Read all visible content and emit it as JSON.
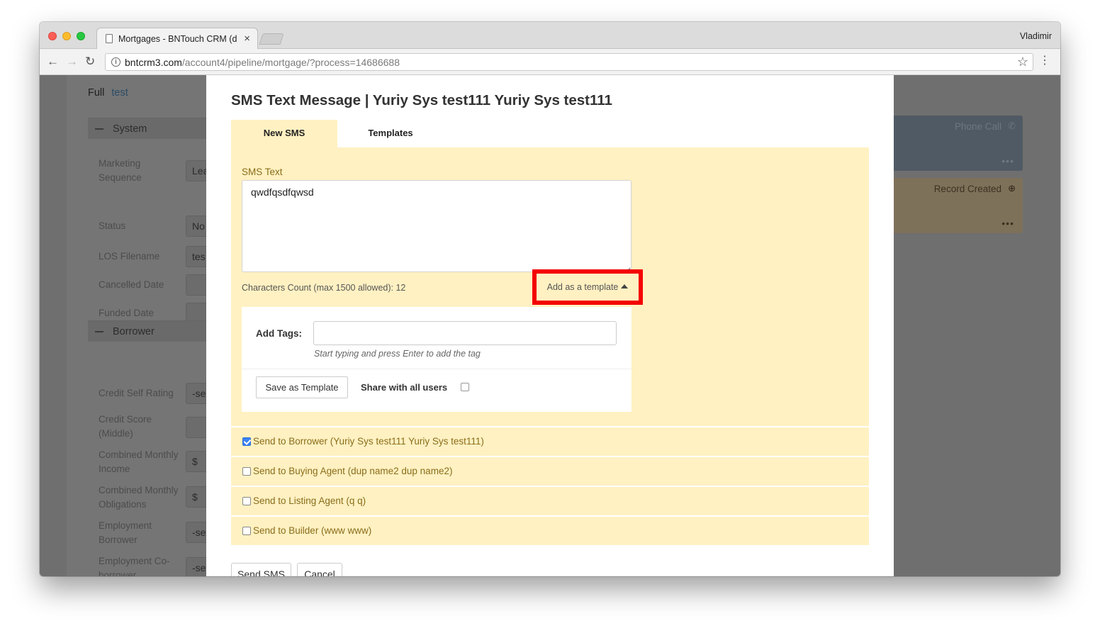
{
  "browser": {
    "tab_title": "Mortgages - BNTouch CRM (d",
    "tab_close": "×",
    "user": "Vladimir",
    "url_host": "bntcrm3.com",
    "url_path": "/account4/pipeline/mortgage/?process=14686688"
  },
  "icons": {
    "back": "←",
    "forward": "→",
    "reload": "↻",
    "info": "i",
    "star": "☆",
    "menu": "⋮",
    "phone": "✆",
    "plus_circle": "⊕",
    "dots": "•••"
  },
  "background": {
    "full_label": "Full",
    "full_value": "test",
    "sections": [
      "System",
      "Borrower"
    ],
    "fields": [
      {
        "label": "Marketing Sequence",
        "value": "Lea"
      },
      {
        "label": "Status",
        "value": "No"
      },
      {
        "label": "LOS Filename",
        "value": "tes"
      },
      {
        "label": "Cancelled Date",
        "value": ""
      },
      {
        "label": "Funded Date",
        "value": ""
      },
      {
        "label": "Credit Self Rating",
        "value": "-se"
      },
      {
        "label": "Credit Score (Middle)",
        "value": ""
      },
      {
        "label": "Combined Monthly Income",
        "value": "$"
      },
      {
        "label": "Combined Monthly Obligations",
        "value": "$"
      },
      {
        "label": "Employment Borrower",
        "value": "-se"
      },
      {
        "label": "Employment Co-borrower",
        "value": "-se"
      }
    ],
    "activity": [
      {
        "title": "Phone Call"
      },
      {
        "title": "Record Created"
      }
    ]
  },
  "modal": {
    "title": "SMS Text Message | Yuriy Sys test111 Yuriy Sys test111",
    "tabs": [
      {
        "label": "New SMS"
      },
      {
        "label": "Templates"
      }
    ],
    "sms_label": "SMS Text",
    "sms_value": "qwdfqsdfqwsd",
    "char_count": "Characters Count (max 1500 allowed): 12",
    "add_template_label": "Add as a template",
    "tags_label": "Add Tags:",
    "tags_hint": "Start typing and press Enter to add the tag",
    "save_template_label": "Save as Template",
    "share_label": "Share with all users",
    "recipients": [
      {
        "label": "Send to Borrower (Yuriy Sys test111 Yuriy Sys test111)",
        "checked": true
      },
      {
        "label": "Send to Buying Agent (dup name2 dup name2)",
        "checked": false
      },
      {
        "label": "Send to Listing Agent (q q)",
        "checked": false
      },
      {
        "label": "Send to Builder (www www)",
        "checked": false
      }
    ],
    "send_label": "Send SMS",
    "cancel_label": "Cancel"
  },
  "colors": {
    "panel_bg": "#fff1c2",
    "label_gold": "#8a6d1a",
    "highlight_red": "#f40000",
    "checkbox_blue": "#3b82f6"
  }
}
